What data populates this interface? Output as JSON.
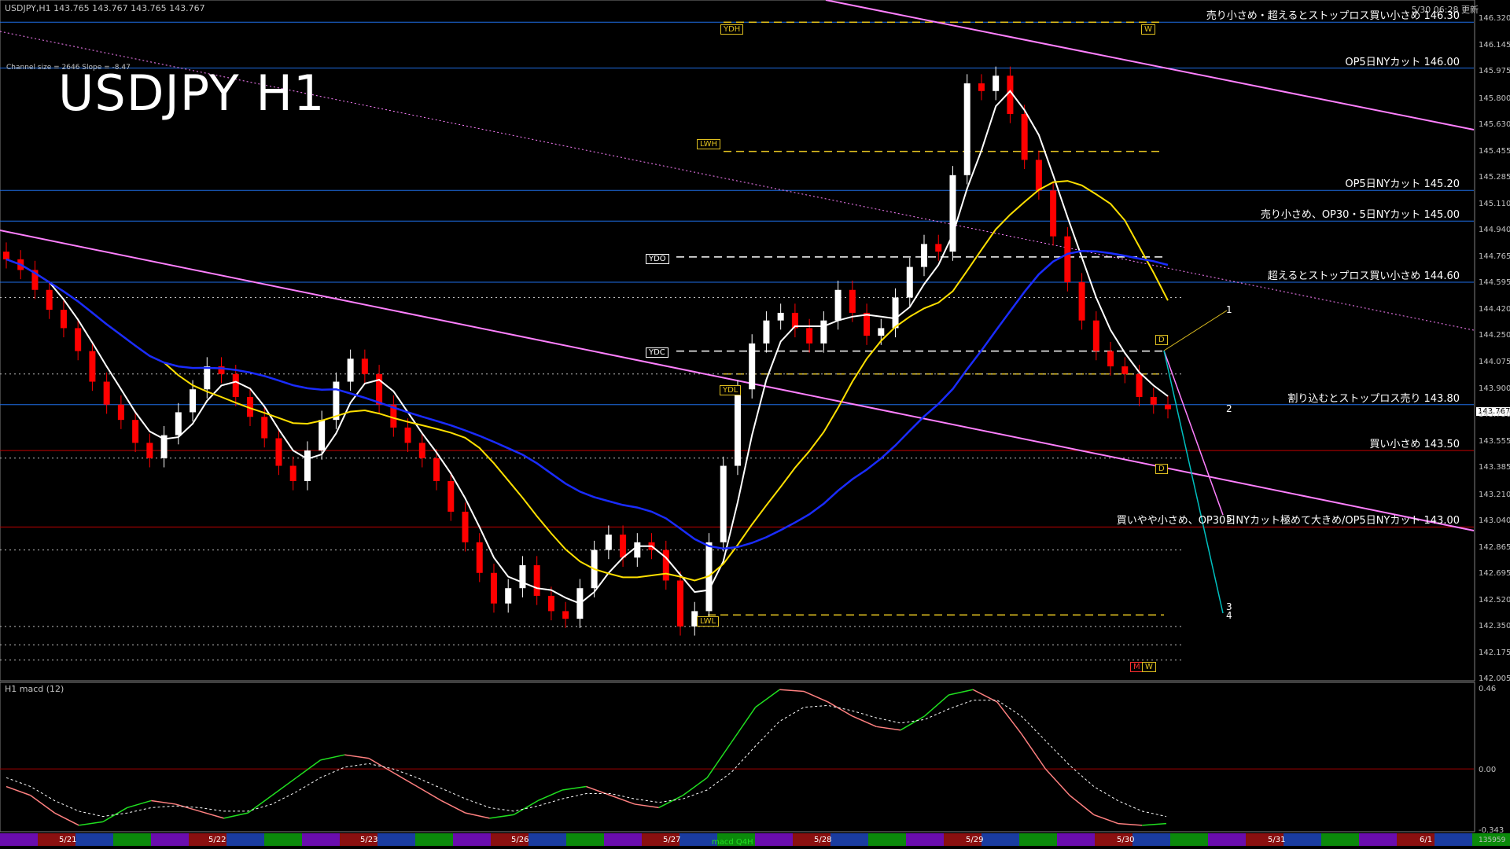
{
  "window": {
    "symbol_info": "USDJPY,H1  143.765 143.767 143.765 143.767",
    "updated": "5/30 06:28 更新",
    "channel_info": "Channel size = 2646 Slope = -8.47",
    "big_title": "USDJPY H1",
    "current_price": "143.767",
    "macd_label": "H1  macd (12)",
    "bottom_right_number": "135959",
    "macd_tag": "macd Q4H"
  },
  "level_notes": [
    {
      "text": "売り小さめ・超えるとストップロス買い小さめ 146.30",
      "price": 146.3
    },
    {
      "text": "OP5日NYカット 146.00",
      "price": 146.0
    },
    {
      "text": "OP5日NYカット 145.20",
      "price": 145.2
    },
    {
      "text": "売り小さめ、OP30・5日NYカット 145.00",
      "price": 145.0
    },
    {
      "text": "超えるとストップロス買い小さめ 144.60",
      "price": 144.6
    },
    {
      "text": "割り込むとストップロス売り 143.80",
      "price": 143.8
    },
    {
      "text": "買い小さめ 143.50",
      "price": 143.5
    },
    {
      "text": "買いやや小さめ、OP30日NYカット極めて大きめ/OP5日NYカット 143.00",
      "price": 143.0
    }
  ],
  "tags": {
    "ydh": "YDH",
    "lwh": "LWH",
    "ydo": "YDO",
    "ydc": "YDC",
    "ydl": "YDL",
    "lwl": "LWL",
    "w_top": "W",
    "d_upper": "D",
    "d_lower": "D",
    "m_bottom": "M",
    "w_bottom": "W"
  },
  "wave_labels": [
    "1",
    "2",
    "3",
    "4",
    "5"
  ],
  "colors": {
    "background": "#000000",
    "bull_candle": "#ffffff",
    "bear_candle": "#ff0000",
    "level_line_blue": "#1e6ee6",
    "level_line_red": "#c00000",
    "channel_line": "#ff80ff",
    "ma_white": "#ffffff",
    "ma_yellow": "#ffe000",
    "ma_blue": "#1a2cff",
    "macd_main": "#20e020",
    "macd_down": "#ff8080"
  },
  "chart_data": {
    "type": "candlestick",
    "symbol": "USDJPY",
    "timeframe": "H1",
    "ylim": [
      142.005,
      146.445
    ],
    "y_ticks": [
      146.32,
      146.145,
      145.975,
      145.8,
      145.63,
      145.455,
      145.285,
      145.11,
      144.94,
      144.765,
      144.595,
      144.42,
      144.25,
      144.075,
      143.9,
      143.73,
      143.555,
      143.385,
      143.21,
      143.04,
      142.865,
      142.695,
      142.52,
      142.35,
      142.175,
      142.005
    ],
    "y_tick_labels": [
      "146.320",
      "146.145",
      "145.975",
      "145.800",
      "145.630",
      "145.455",
      "145.285",
      "145.110",
      "144.940",
      "144.765",
      "144.595",
      "144.420",
      "144.250",
      "144.075",
      "143.900",
      "143.730",
      "143.555",
      "143.385",
      "143.210",
      "143.040",
      "142.865",
      "142.695",
      "142.520",
      "142.350",
      "142.175",
      "142.005"
    ],
    "x_tick_labels": [
      "5/21",
      "5/22",
      "5/23",
      "5/26",
      "5/27",
      "5/28",
      "5/29",
      "5/30",
      "5/31",
      "6/1"
    ],
    "close_series": [
      144.75,
      144.68,
      144.55,
      144.42,
      144.3,
      144.15,
      143.95,
      143.8,
      143.7,
      143.55,
      143.45,
      143.6,
      143.75,
      143.9,
      144.05,
      144.0,
      143.85,
      143.72,
      143.58,
      143.4,
      143.3,
      143.5,
      143.7,
      143.95,
      144.1,
      144.0,
      143.8,
      143.65,
      143.55,
      143.45,
      143.3,
      143.1,
      142.9,
      142.7,
      142.5,
      142.6,
      142.75,
      142.55,
      142.45,
      142.4,
      142.6,
      142.85,
      142.95,
      142.8,
      142.9,
      142.85,
      142.65,
      142.35,
      142.45,
      142.9,
      143.4,
      143.9,
      144.2,
      144.35,
      144.4,
      144.3,
      144.2,
      144.35,
      144.55,
      144.4,
      144.25,
      144.3,
      144.5,
      144.7,
      144.85,
      144.8,
      145.3,
      145.9,
      145.85,
      145.95,
      145.7,
      145.4,
      145.2,
      144.9,
      144.6,
      144.35,
      144.15,
      144.05,
      144.0,
      143.85,
      143.8,
      143.77
    ],
    "macd": {
      "ylim": [
        -0.343,
        0.46
      ],
      "y_tick_labels": [
        "0.46",
        "0.00",
        "-0.343"
      ],
      "main": [
        -0.1,
        -0.15,
        -0.25,
        -0.32,
        -0.3,
        -0.22,
        -0.18,
        -0.2,
        -0.24,
        -0.28,
        -0.25,
        -0.15,
        -0.05,
        0.05,
        0.08,
        0.06,
        -0.02,
        -0.1,
        -0.18,
        -0.25,
        -0.28,
        -0.26,
        -0.18,
        -0.12,
        -0.1,
        -0.15,
        -0.2,
        -0.22,
        -0.15,
        -0.05,
        0.15,
        0.35,
        0.45,
        0.44,
        0.38,
        0.3,
        0.24,
        0.22,
        0.3,
        0.42,
        0.45,
        0.38,
        0.2,
        0.0,
        -0.15,
        -0.26,
        -0.31,
        -0.32,
        -0.31
      ],
      "signal": [
        -0.05,
        -0.1,
        -0.18,
        -0.24,
        -0.27,
        -0.25,
        -0.22,
        -0.21,
        -0.22,
        -0.24,
        -0.24,
        -0.2,
        -0.13,
        -0.05,
        0.01,
        0.03,
        0.0,
        -0.05,
        -0.11,
        -0.17,
        -0.22,
        -0.24,
        -0.21,
        -0.17,
        -0.14,
        -0.14,
        -0.17,
        -0.19,
        -0.17,
        -0.12,
        -0.02,
        0.13,
        0.27,
        0.35,
        0.36,
        0.33,
        0.29,
        0.26,
        0.28,
        0.34,
        0.39,
        0.39,
        0.3,
        0.16,
        0.02,
        -0.1,
        -0.18,
        -0.24,
        -0.27
      ]
    }
  }
}
